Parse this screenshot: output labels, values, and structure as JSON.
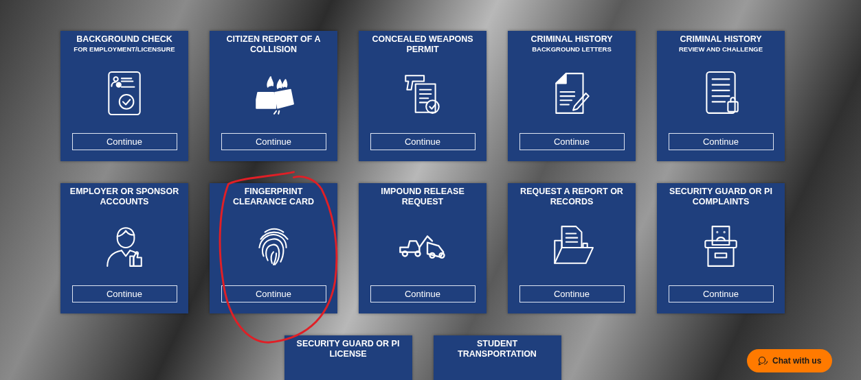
{
  "cards": [
    {
      "title": "BACKGROUND CHECK",
      "subtitle": "FOR EMPLOYMENT/LICENSURE",
      "button": "Continue"
    },
    {
      "title": "CITIZEN REPORT OF A COLLISION",
      "button": "Continue"
    },
    {
      "title": "CONCEALED WEAPONS PERMIT",
      "button": "Continue"
    },
    {
      "title": "CRIMINAL HISTORY",
      "subtitle": "BACKGROUND LETTERS",
      "button": "Continue"
    },
    {
      "title": "CRIMINAL HISTORY",
      "subtitle": "REVIEW AND CHALLENGE",
      "button": "Continue"
    },
    {
      "title": "EMPLOYER OR SPONSOR ACCOUNTS",
      "button": "Continue"
    },
    {
      "title": "FINGERPRINT CLEARANCE CARD",
      "button": "Continue"
    },
    {
      "title": "IMPOUND RELEASE REQUEST",
      "button": "Continue"
    },
    {
      "title": "REQUEST A REPORT OR RECORDS",
      "button": "Continue"
    },
    {
      "title": "SECURITY GUARD OR PI COMPLAINTS",
      "button": "Continue"
    },
    {
      "title": "SECURITY GUARD OR PI LICENSE"
    },
    {
      "title": "STUDENT TRANSPORTATION"
    }
  ],
  "chat": {
    "label": "Chat with us"
  }
}
